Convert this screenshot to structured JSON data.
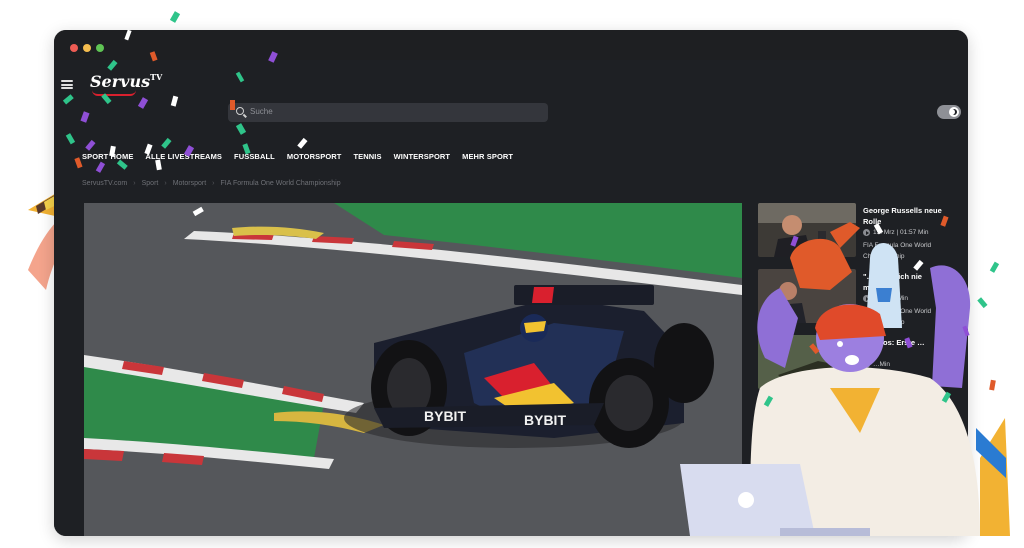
{
  "site": {
    "logo_text": "Servus",
    "logo_suffix": "TV",
    "search_placeholder": "Suche"
  },
  "nav": {
    "items": [
      "SPORT HOME",
      "ALLE LIVESTREAMS",
      "FUSSBALL",
      "MOTORSPORT",
      "TENNIS",
      "WINTERSPORT",
      "MEHR SPORT"
    ]
  },
  "breadcrumb": [
    "ServusTV.com",
    "Sport",
    "Motorsport",
    "FIA Formula One World Championship"
  ],
  "hero": {
    "car_sponsor": "BYBIT"
  },
  "sidebar": {
    "cards": [
      {
        "title": "George Russells neue Rolle",
        "meta": "15. Mrz | 01:57 Min",
        "category": "FIA Formula One World Championship"
      },
      {
        "title": "\"…würde ich nie machen\"",
        "meta": "…02:50 Min",
        "category": "FIA Formula One World Championship"
      },
      {
        "title": "…Autos: Erste …",
        "meta": "…Min",
        "category": "…World"
      },
      {
        "title": "… F1-75 von …",
        "meta": "",
        "category": ""
      }
    ]
  },
  "colors": {
    "page_bg": "#1e2024",
    "accent_red": "#d9202e",
    "toggle": "#8e9096"
  }
}
